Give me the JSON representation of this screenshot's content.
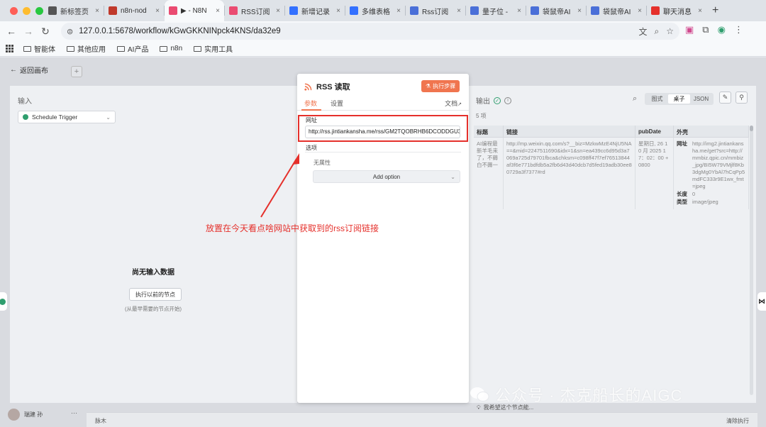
{
  "browser": {
    "tabs": [
      {
        "label": "新标签页",
        "icon_color": "#555555",
        "active": false
      },
      {
        "label": "n8n-nod",
        "icon_color": "#c0392b",
        "active": false
      },
      {
        "label": "▶ - N8N",
        "icon_color": "#ea4b71",
        "active": true
      },
      {
        "label": "RSS订阅",
        "icon_color": "#ea4b71",
        "active": false
      },
      {
        "label": "新增记录",
        "icon_color": "#3370ff",
        "active": false
      },
      {
        "label": "多维表格",
        "icon_color": "#3370ff",
        "active": false
      },
      {
        "label": "Rss订阅",
        "icon_color": "#4a6fd8",
        "active": false
      },
      {
        "label": "量子位 -",
        "icon_color": "#4a6fd8",
        "active": false
      },
      {
        "label": "袋鼠帝AI",
        "icon_color": "#4a6fd8",
        "active": false
      },
      {
        "label": "袋鼠帝AI",
        "icon_color": "#4a6fd8",
        "active": false
      },
      {
        "label": "聊天消息",
        "icon_color": "#e5302b",
        "active": false
      }
    ],
    "url": "127.0.0.1:5678/workflow/kGwGKKNINpck4KNS/da32e9",
    "bookmarks": [
      "智能体",
      "其他应用",
      "AI产品",
      "n8n",
      "实用工具"
    ]
  },
  "app": {
    "back_label": "返回画布",
    "input_panel": {
      "title": "输入",
      "trigger": "Schedule Trigger",
      "empty_title": "尚无输入数据",
      "exec_prev_button": "执行以前的节点",
      "empty_hint": "(从最早需要的节点开始)"
    },
    "modal": {
      "title": "RSS 读取",
      "exec_button": "执行步骤",
      "tab_params": "参数",
      "tab_settings": "设置",
      "docs": "文档",
      "url_label": "网址",
      "url_value": "http://rss.jintiankansha.me/rss/GM2TQOBRHB6DCODDGU3",
      "options_label": "选项",
      "no_props": "无属性",
      "add_option": "Add option"
    },
    "output_panel": {
      "title": "输出",
      "count": "5 项",
      "views": [
        "图式",
        "桌子",
        "JSON"
      ],
      "selected_view": "桌子",
      "columns": [
        "标题",
        "链接",
        "pubDate",
        "外壳"
      ],
      "row": {
        "title": "AI编程最新羊毛来了，不薅白不薅一",
        "link": "http://mp.weixin.qq.com/s?__biz=MzkwMzE4NjU5NA==&mid=2247511690&idx=1&sn=ea439cc6d95d3a7069a725d79701fbca&chksm=c098ff47f7ef76513844af3f6e771bdfdb5a2fb6d43d40dcb7d5fed19adb30ee80729a3f7377#rd",
        "pubDate": "星期日, 26 10 月 2025 17：02：00 +0800",
        "enclosure": [
          {
            "k": "网址",
            "v": "http://img2.jintiankansha.me/get?src=http://mmbiz.qpic.cn/mmbiz_jpg/BI5W79VMjlf8Kb3dgMg0YbAl7hCqPp5mdFC333r9E1wx_fmt=jpeg"
          },
          {
            "k": "长度",
            "v": "0"
          },
          {
            "k": "类型",
            "v": "image/jpeg"
          }
        ]
      },
      "hint": "我希望这个节点能..."
    },
    "user": "瑞建 孙",
    "bottom_bar_left": "脉木",
    "bottom_bar_right": "清除执行"
  },
  "annotation": "放置在今天看点啥网站中获取到的rss订阅链接",
  "watermark": "公众号 · 杰克船长的AIGC",
  "colors": {
    "accent": "#f0754f",
    "highlight": "#e5302b",
    "success": "#2f9e6e"
  }
}
